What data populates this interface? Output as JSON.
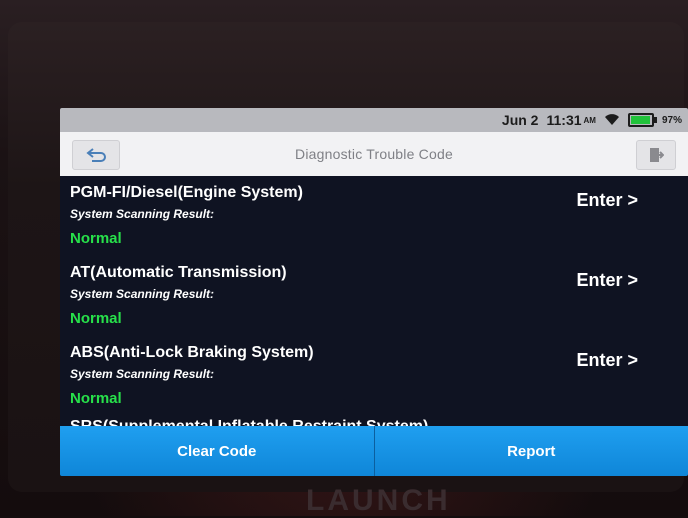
{
  "status": {
    "date": "Jun 2",
    "time": "11:31",
    "ampm": "AM",
    "battery_percent": "97%",
    "battery_level": 0.97,
    "battery_color": "#21c23a"
  },
  "header": {
    "title": "Diagnostic Trouble Code",
    "back_icon": "back-arrow-icon",
    "exit_icon": "exit-icon"
  },
  "systems": [
    {
      "name": "PGM-FI/Diesel(Engine System)",
      "result_label": "System Scanning Result:",
      "status": "Normal",
      "action": "Enter >"
    },
    {
      "name": "AT(Automatic Transmission)",
      "result_label": "System Scanning Result:",
      "status": "Normal",
      "action": "Enter >"
    },
    {
      "name": "ABS(Anti-Lock Braking System)",
      "result_label": "System Scanning Result:",
      "status": "Normal",
      "action": "Enter >"
    }
  ],
  "partial_item": "SRS(Supplemental Inflatable Restraint System)",
  "footer": {
    "clear_code": "Clear Code",
    "report": "Report"
  },
  "device_brand": "LAUNCH",
  "colors": {
    "status_normal": "#27e04a",
    "footer_button": "#1592e0"
  }
}
